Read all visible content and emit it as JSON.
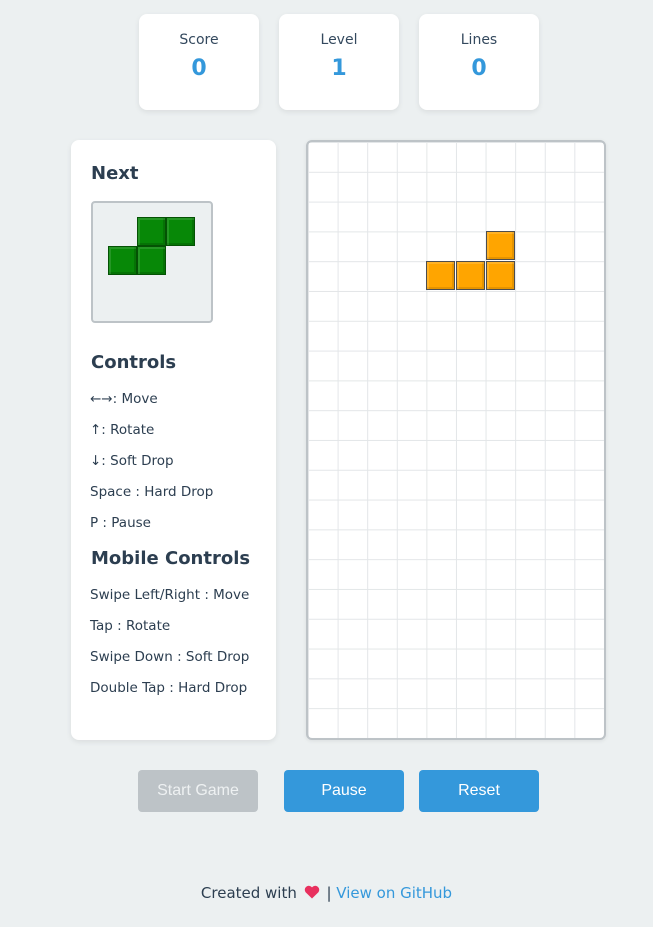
{
  "stats": {
    "score_label": "Score",
    "score_value": "0",
    "level_label": "Level",
    "level_value": "1",
    "lines_label": "Lines",
    "lines_value": "0"
  },
  "sidebar": {
    "next_title": "Next",
    "next_piece": {
      "shape": "S",
      "color": "#078807"
    },
    "controls_title": "Controls",
    "controls": [
      "←→: Move",
      "↑: Rotate",
      "↓: Soft Drop",
      "Space : Hard Drop",
      "P : Pause"
    ],
    "mobile_title": "Mobile Controls",
    "mobile_controls": [
      "Swipe Left/Right : Move",
      "Tap : Rotate",
      "Swipe Down : Soft Drop",
      "Double Tap : Hard Drop"
    ]
  },
  "board": {
    "columns": 10,
    "rows": 20,
    "active_piece": {
      "shape": "L",
      "color": "#ffa500"
    }
  },
  "buttons": {
    "start": "Start Game",
    "pause": "Pause",
    "reset": "Reset"
  },
  "footer": {
    "created_text": "Created with",
    "separator": "|",
    "github_link": "View on GitHub",
    "heart_icon": "heart-icon"
  }
}
